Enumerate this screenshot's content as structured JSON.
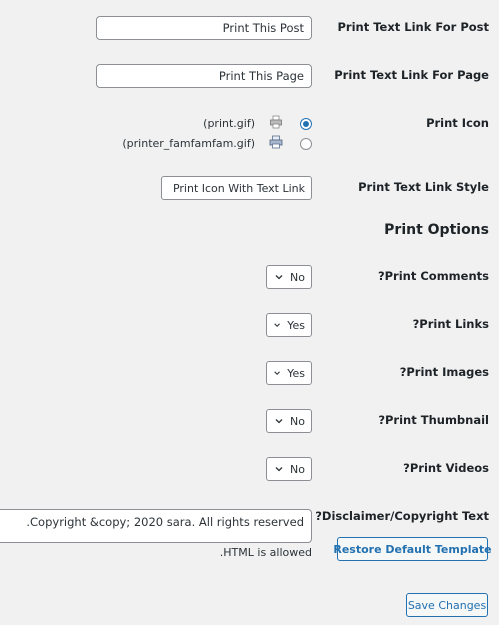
{
  "fields": {
    "post_link": {
      "label": "Print Text Link For Post",
      "value": "Print This Post"
    },
    "page_link": {
      "label": "Print Text Link For Page",
      "value": "Print This Page"
    },
    "print_icon": {
      "label": "Print Icon",
      "options": [
        {
          "label": "(print.gif)",
          "icon": "printer-icon",
          "checked": true
        },
        {
          "label": "(printer_famfamfam.gif)",
          "icon": "printer-icon",
          "checked": false
        }
      ]
    },
    "link_style": {
      "label": "Print Text Link Style",
      "value": "Print Icon With Text Link"
    }
  },
  "print_options": {
    "title": "Print Options",
    "comments": {
      "label": "?Print Comments",
      "value": "No"
    },
    "links": {
      "label": "?Print Links",
      "value": "Yes"
    },
    "images": {
      "label": "?Print Images",
      "value": "Yes"
    },
    "thumbnail": {
      "label": "?Print Thumbnail",
      "value": "No"
    },
    "videos": {
      "label": "?Print Videos",
      "value": "No"
    },
    "disclaimer": {
      "label": "?Disclaimer/Copyright Text",
      "value": ".Copyright &copy; 2020 sara. All rights reserved",
      "note": ".HTML is allowed",
      "restore_label": "Restore Default Template"
    }
  },
  "actions": {
    "save_label": "Save Changes"
  },
  "colors": {
    "accent": "#2271b1",
    "background": "#f1f1f1"
  }
}
